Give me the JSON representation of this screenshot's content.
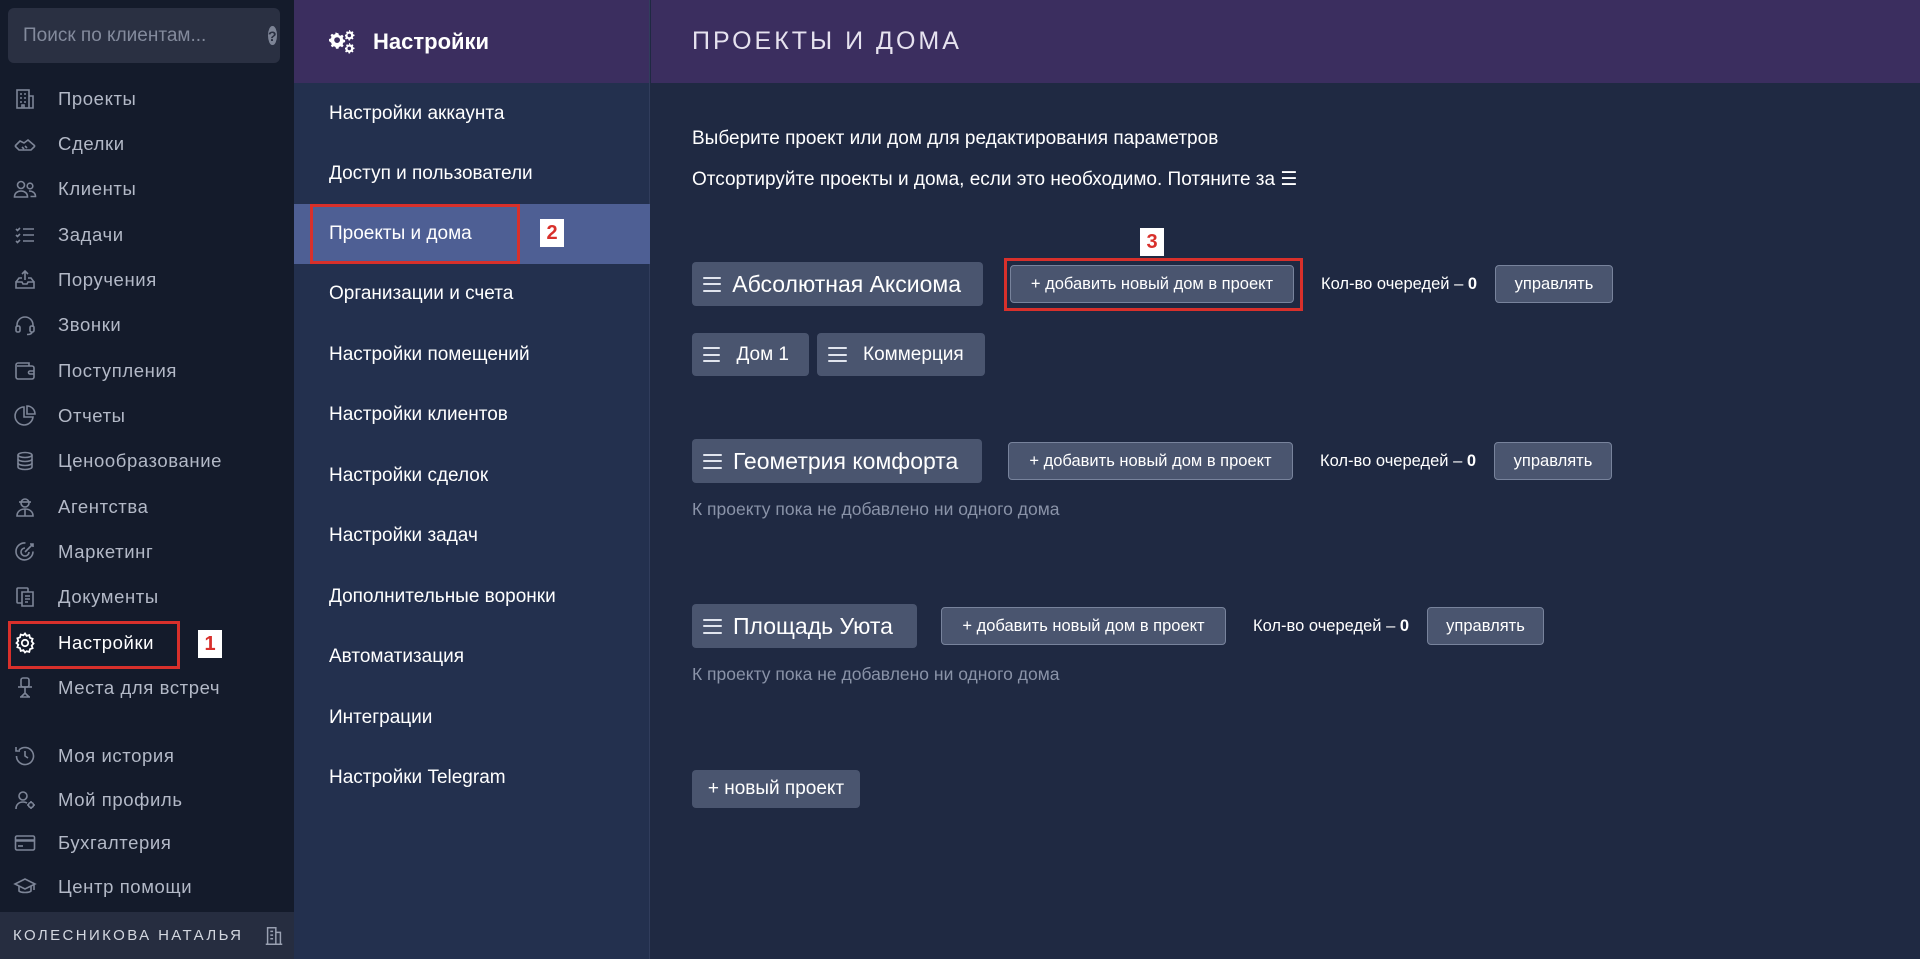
{
  "search": {
    "placeholder": "Поиск по клиентам..."
  },
  "nav": {
    "items": [
      {
        "label": "Проекты",
        "icon": "building-icon",
        "key": "projects"
      },
      {
        "label": "Сделки",
        "icon": "handshake-icon",
        "key": "deals"
      },
      {
        "label": "Клиенты",
        "icon": "users-icon",
        "key": "clients"
      },
      {
        "label": "Задачи",
        "icon": "checklist-icon",
        "key": "tasks"
      },
      {
        "label": "Поручения",
        "icon": "inbox-upload-icon",
        "key": "assignments"
      },
      {
        "label": "Звонки",
        "icon": "headset-icon",
        "key": "calls"
      },
      {
        "label": "Поступления",
        "icon": "wallet-icon",
        "key": "receipts"
      },
      {
        "label": "Отчеты",
        "icon": "pie-chart-icon",
        "key": "reports"
      },
      {
        "label": "Ценообразование",
        "icon": "coins-icon",
        "key": "pricing"
      },
      {
        "label": "Агентства",
        "icon": "agent-icon",
        "key": "agencies"
      },
      {
        "label": "Маркетинг",
        "icon": "target-icon",
        "key": "marketing"
      },
      {
        "label": "Документы",
        "icon": "documents-icon",
        "key": "documents"
      },
      {
        "label": "Настройки",
        "icon": "gear-icon",
        "key": "settings",
        "active": true
      },
      {
        "label": "Места для встреч",
        "icon": "desk-chair-icon",
        "key": "meeting-places"
      },
      {
        "label": "Моя история",
        "icon": "history-icon",
        "key": "my-history"
      },
      {
        "label": "Мой профиль",
        "icon": "user-profile-icon",
        "key": "my-profile"
      },
      {
        "label": "Бухгалтерия",
        "icon": "card-icon",
        "key": "accounting"
      },
      {
        "label": "Центр помощи",
        "icon": "graduation-cap-icon",
        "key": "help-center"
      }
    ],
    "user": {
      "name": "КОЛЕСНИКОВА НАТАЛЬЯ",
      "icon": "office-building-icon"
    }
  },
  "settings_menu": {
    "title": "Настройки",
    "icon": "gears-icon",
    "items": [
      {
        "label": "Настройки аккаунта"
      },
      {
        "label": "Доступ и пользователи"
      },
      {
        "label": "Проекты и дома",
        "active": true
      },
      {
        "label": "Организации и счета"
      },
      {
        "label": "Настройки помещений"
      },
      {
        "label": "Настройки клиентов"
      },
      {
        "label": "Настройки сделок"
      },
      {
        "label": "Настройки задач"
      },
      {
        "label": "Дополнительные воронки"
      },
      {
        "label": "Автоматизация"
      },
      {
        "label": "Интеграции"
      },
      {
        "label": "Настройки Telegram"
      }
    ]
  },
  "main": {
    "title": "ПРОЕКТЫ И ДОМА",
    "hint1": "Выберите проект или дом для редактирования параметров",
    "hint2": "Отсортируйте проекты и дома, если это необходимо. Потяните за ☰",
    "add_house_label": "+ добавить новый дом в проект",
    "queues_label": "Кол-во очередей –",
    "manage_label": "управлять",
    "no_houses_text": "К проекту пока не добавлено ни одного дома",
    "new_project_label": "+ новый проект",
    "projects": [
      {
        "name": "Абсолютная Аксиома",
        "queues": "0",
        "houses": [
          "Дом 1",
          "Коммерция"
        ]
      },
      {
        "name": "Геометрия комфорта",
        "queues": "0",
        "houses": []
      },
      {
        "name": "Площадь Уюта",
        "queues": "0",
        "houses": []
      }
    ]
  },
  "annotations": {
    "step1": "1",
    "step2": "2",
    "step3": "3"
  },
  "colors": {
    "nav_bg": "#141b2b",
    "menu_bg": "#23304e",
    "main_bg": "#1f2942",
    "header_bg": "#3b2e5f",
    "active_item_bg": "#4e5f94",
    "chip_bg": "#4a556f",
    "callout_red": "#d8302b"
  }
}
